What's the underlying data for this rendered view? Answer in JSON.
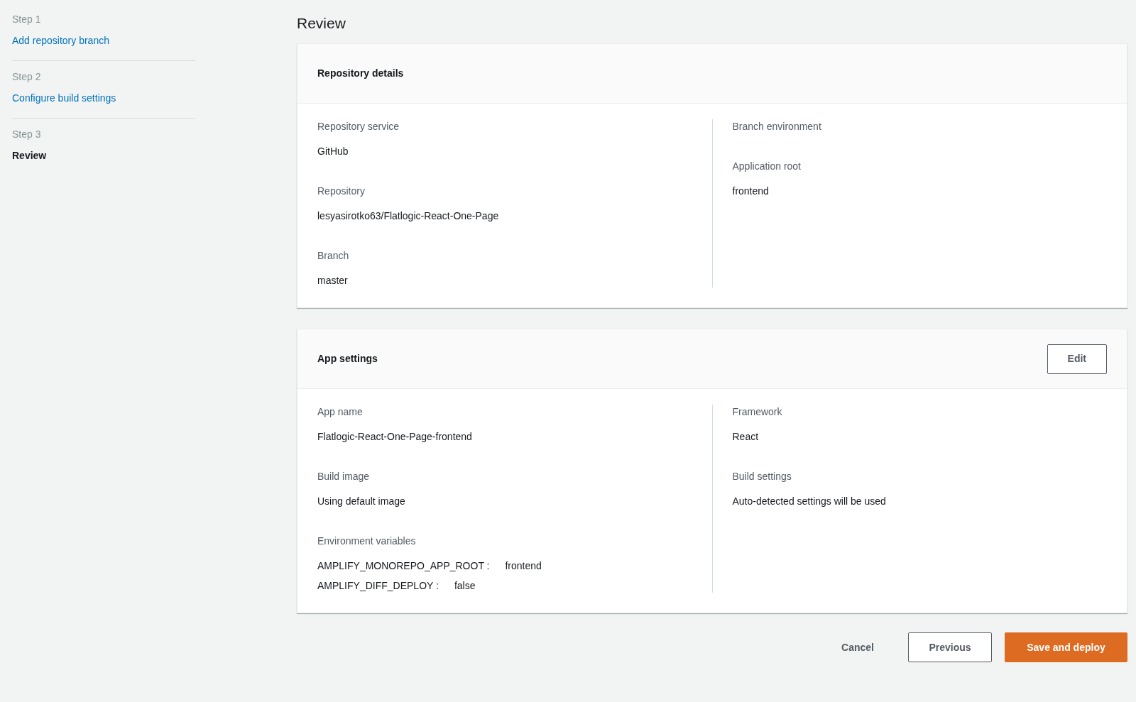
{
  "steps": [
    {
      "step": "Step 1",
      "title": "Add repository branch",
      "selected": false
    },
    {
      "step": "Step 2",
      "title": "Configure build settings",
      "selected": false
    },
    {
      "step": "Step 3",
      "title": "Review",
      "selected": true
    }
  ],
  "page_title": "Review",
  "cards": [
    {
      "title": "Repository details",
      "columns": [
        [
          {
            "label": "Repository service",
            "value": "GitHub"
          },
          {
            "label": "Repository",
            "value": "lesyasirotko63/Flatlogic-React-One-Page"
          },
          {
            "label": "Branch",
            "value": "master"
          }
        ],
        [
          {
            "label": "Branch environment"
          },
          {
            "label": "Application root",
            "value": "frontend"
          }
        ]
      ]
    },
    {
      "title": "App settings",
      "edit_button": "Edit",
      "columns": [
        [
          {
            "label": "App name",
            "value": "Flatlogic-React-One-Page-frontend"
          },
          {
            "label": "Build image",
            "value": "Using default image"
          },
          {
            "label": "Environment variables",
            "variables": [
              {
                "key": "AMPLIFY_MONOREPO_APP_ROOT :",
                "value": "frontend"
              },
              {
                "key": "AMPLIFY_DIFF_DEPLOY :",
                "value": "false"
              }
            ]
          }
        ],
        [
          {
            "label": "Framework",
            "value": "React"
          },
          {
            "label": "Build settings",
            "value": "Auto-detected settings will be used"
          }
        ]
      ]
    }
  ],
  "actions": {
    "cancel": "Cancel",
    "previous": "Previous",
    "primary": "Save and deploy"
  }
}
